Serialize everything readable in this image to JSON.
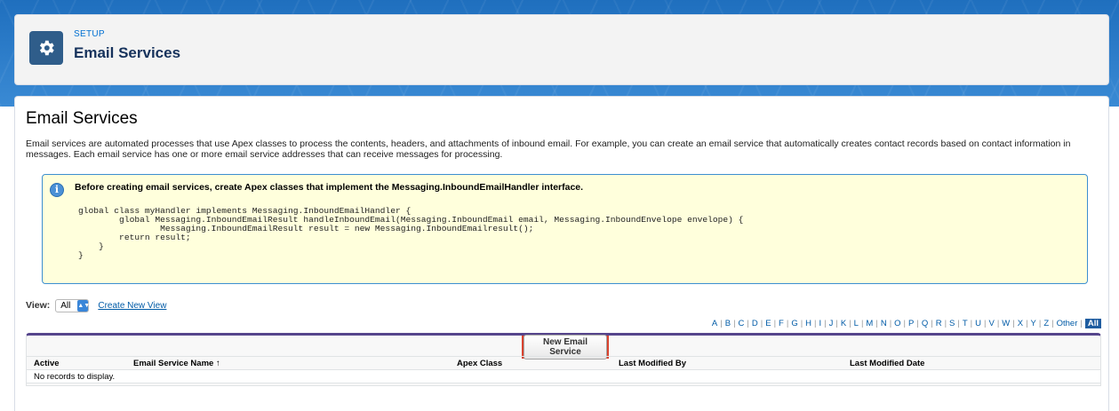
{
  "header": {
    "setup_label": "SETUP",
    "title": "Email Services",
    "icon": "gear-icon"
  },
  "main": {
    "title": "Email Services",
    "description": "Email services are automated processes that use Apex classes to process the contents, headers, and attachments of inbound email. For example, you can create an email service that automatically creates contact records based on contact information in messages. Each email service has one or more email service addresses that can receive messages for processing."
  },
  "info_box": {
    "icon": "info-icon",
    "title": "Before creating email services, create Apex classes that implement the Messaging.InboundEmailHandler interface.",
    "code": "global class myHandler implements Messaging.InboundEmailHandler {\n        global Messaging.InboundEmailResult handleInboundEmail(Messaging.InboundEmail email, Messaging.InboundEnvelope envelope) {\n                Messaging.InboundEmailResult result = new Messaging.InboundEmailresult();\n        return result;\n    }\n}"
  },
  "view": {
    "label": "View:",
    "selected": "All",
    "create_link": "Create New View"
  },
  "alphabet": [
    "A",
    "B",
    "C",
    "D",
    "E",
    "F",
    "G",
    "H",
    "I",
    "J",
    "K",
    "L",
    "M",
    "N",
    "O",
    "P",
    "Q",
    "R",
    "S",
    "T",
    "U",
    "V",
    "W",
    "X",
    "Y",
    "Z",
    "Other",
    "All"
  ],
  "alphabet_selected": "All",
  "list": {
    "new_button": "New Email Service",
    "columns": [
      "Active",
      "Email Service Name ↑",
      "Apex Class",
      "Last Modified By",
      "Last Modified Date"
    ],
    "empty_text": "No records to display."
  },
  "colors": {
    "accent_band": "#2d7bc9",
    "highlight_border": "#d9432f",
    "list_header_bar": "#56458c",
    "link": "#015ba7"
  }
}
